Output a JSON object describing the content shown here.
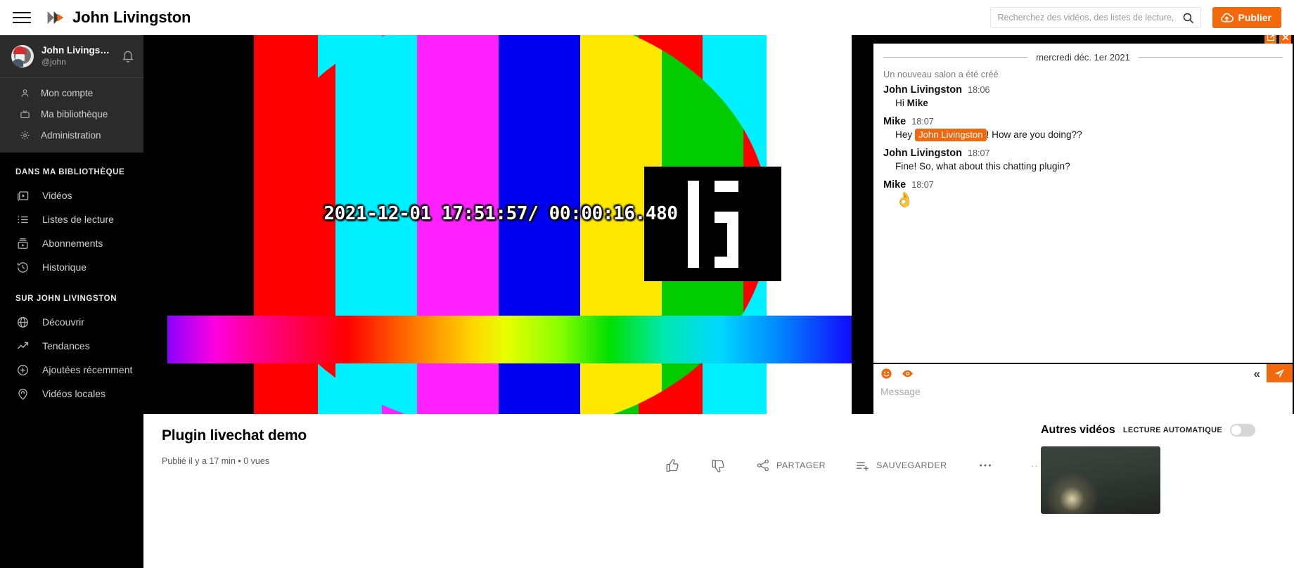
{
  "header": {
    "hamburger_label": "menu",
    "brand_title": "John Livingston",
    "search_placeholder": "Recherchez des vidéos, des listes de lecture, des chaînes…",
    "search_value": "",
    "publish_label": "Publier"
  },
  "sidebar": {
    "account": {
      "display_name": "John Livings…",
      "handle": "@john",
      "bell_icon": "bell-icon"
    },
    "account_items": [
      {
        "label": "Mon compte",
        "icon": "user-icon"
      },
      {
        "label": "Ma bibliothèque",
        "icon": "tv-icon"
      },
      {
        "label": "Administration",
        "icon": "gear-icon"
      }
    ],
    "library_section_title": "DANS MA BIBLIOTHÈQUE",
    "library_items": [
      {
        "label": "Vidéos",
        "icon": "video-library-icon"
      },
      {
        "label": "Listes de lecture",
        "icon": "playlist-icon"
      },
      {
        "label": "Abonnements",
        "icon": "subscriptions-icon"
      },
      {
        "label": "Historique",
        "icon": "history-icon"
      }
    ],
    "instance_section_title": "SUR JOHN LIVINGSTON",
    "instance_items": [
      {
        "label": "Découvrir",
        "icon": "globe-icon"
      },
      {
        "label": "Tendances",
        "icon": "trending-icon"
      },
      {
        "label": "Ajoutées récemment",
        "icon": "plus-circle-icon"
      },
      {
        "label": "Vidéos locales",
        "icon": "location-pin-icon"
      }
    ]
  },
  "player": {
    "timestamp_overlay": "2021-12-01 17:51:57/ 00:00:16.480",
    "bar_colors": [
      "#fe0000",
      "#00f0ff",
      "#ff22ff",
      "#0000f0",
      "#ffe800",
      "#00cc00",
      "#fe0000",
      "#00f0ff"
    ]
  },
  "chat": {
    "window_buttons": [
      {
        "name": "open-in-new-icon",
        "label": "open in new window"
      },
      {
        "name": "close-icon",
        "label": "close"
      }
    ],
    "day_separator": "mercredi déc. 1er 2021",
    "system_message": "Un nouveau salon a été créé",
    "messages": [
      {
        "nick": "John Livingston",
        "time": "18:06",
        "parts": [
          {
            "type": "text",
            "text": "Hi "
          },
          {
            "type": "bold",
            "text": "Mike"
          }
        ]
      },
      {
        "nick": "Mike",
        "time": "18:07",
        "parts": [
          {
            "type": "text",
            "text": "Hey "
          },
          {
            "type": "mention",
            "text": "John Livingston"
          },
          {
            "type": "text",
            "text": "! How are you doing??"
          }
        ]
      },
      {
        "nick": "John Livingston",
        "time": "18:07",
        "parts": [
          {
            "type": "text",
            "text": "Fine! So, what about this chatting plugin?"
          }
        ]
      },
      {
        "nick": "Mike",
        "time": "18:07",
        "parts": [
          {
            "type": "emoji",
            "text": "👌"
          }
        ]
      }
    ],
    "toolbar": {
      "emoji_icon": "smiley-icon",
      "visibility_icon": "eye-icon",
      "collapse_label": "«",
      "send_icon": "send-icon"
    },
    "input_placeholder": "Message",
    "input_value": ""
  },
  "video": {
    "title": "Plugin livechat demo",
    "subtitle": "Publié il y a 17 min • 0 vues",
    "actions": [
      {
        "label": "",
        "icon": "thumbs-up-icon",
        "name": "like-button"
      },
      {
        "label": "",
        "icon": "thumbs-down-icon",
        "name": "dislike-button"
      },
      {
        "label": "PARTAGER",
        "icon": "share-icon",
        "name": "share-button"
      },
      {
        "label": "SAUVEGARDER",
        "icon": "save-playlist-icon",
        "name": "save-button"
      },
      {
        "label": "",
        "icon": "more-horizontal-icon",
        "name": "more-actions-button"
      }
    ]
  },
  "others": {
    "title": "Autres vidéos",
    "autoplay_label": "LECTURE AUTOMATIQUE",
    "autoplay_on": false
  },
  "colors": {
    "accent": "#F1680D",
    "sidebar_bg": "#000000",
    "sidebar_account_bg": "#2b2b2b"
  }
}
